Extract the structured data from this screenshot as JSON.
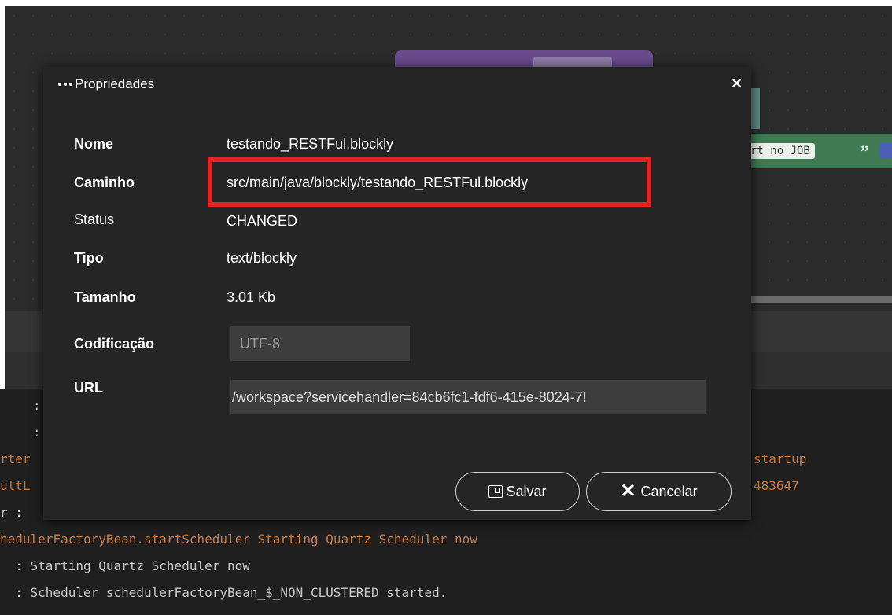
{
  "modal": {
    "title": "Propriedades",
    "close_symbol": "×",
    "fields": {
      "nome": {
        "label": "Nome",
        "value": "testando_RESTFul.blockly"
      },
      "caminho": {
        "label": "Caminho",
        "value": "src/main/java/blockly/testando_RESTFul.blockly"
      },
      "status": {
        "label": "Status",
        "value": "CHANGED"
      },
      "tipo": {
        "label": "Tipo",
        "value": "text/blockly"
      },
      "tamanho": {
        "label": "Tamanho",
        "value": "3.01 Kb"
      },
      "codificacao": {
        "label": "Codificação",
        "value": "UTF-8"
      },
      "url": {
        "label": "URL",
        "value": "/workspace?servicehandler=84cb6fc1-fdf6-415e-8024-7!"
      }
    },
    "buttons": {
      "save_label": "Salvar",
      "cancel_label": "Cancelar",
      "cancel_icon": "✕"
    },
    "highlight_color": "#e52421"
  },
  "background": {
    "block_text": "rt no JOB",
    "block_quote": "”",
    "console": {
      "left_fragments": [
        ":",
        ":",
        "rter",
        "ultL",
        "r :"
      ],
      "right_fragments": [
        "startup",
        "483647"
      ],
      "lines": [
        "hedulerFactoryBean.startScheduler Starting Quartz Scheduler now",
        "  : Starting Quartz Scheduler now",
        "  : Scheduler schedulerFactoryBean_$_NON_CLUSTERED started."
      ]
    }
  },
  "colors": {
    "modal_bg": "#252525",
    "workspace_bg": "#2b2b2b",
    "console_bg": "#1f1f1f",
    "console_orange": "#c87a44"
  }
}
